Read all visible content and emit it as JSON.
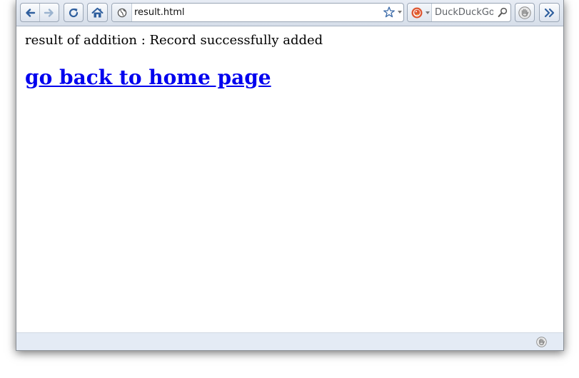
{
  "toolbar": {
    "back_icon": "back-arrow-icon",
    "forward_icon": "forward-arrow-icon",
    "reload_icon": "reload-icon",
    "home_icon": "home-icon",
    "adblock_icon": "hand-stop-icon",
    "overflow_icon": "chevron-double-right-icon"
  },
  "urlbar": {
    "value": "result.html",
    "identity_icon": "globe-icon",
    "bookmark_icon": "star-icon"
  },
  "search": {
    "engine_icon": "duckduckgo-icon",
    "placeholder": "DuckDuckGo",
    "search_icon": "magnifier-icon"
  },
  "page": {
    "result_text": "result of addition : Record successfully added",
    "home_link": "go back to home page"
  },
  "statusbar": {
    "icon": "hand-stop-icon"
  },
  "colors": {
    "link": "#0000ee",
    "toolbar_top": "#e7ecf4",
    "toolbar_bottom": "#d6dee9",
    "statusbar": "#e4ebf5",
    "icon_blue": "#2f5f9e"
  }
}
